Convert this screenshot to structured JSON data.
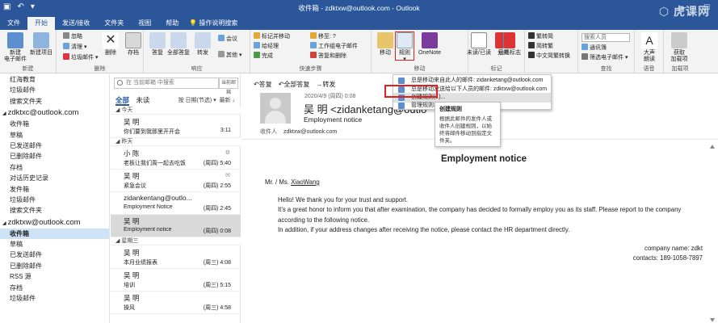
{
  "titlebar": {
    "title": "收件箱 - zdktxw@outlook.com - Outlook"
  },
  "tabs": [
    "文件",
    "开始",
    "发送/接收",
    "文件夹",
    "视图",
    "帮助"
  ],
  "tell_me": "操作说明搜索",
  "ribbon": {
    "new_email": "新建\n电子邮件",
    "new_items": "新建项目",
    "ignore": "忽略",
    "clean": "清理",
    "junk": "垃圾邮件",
    "delete": "删除",
    "archive": "存档",
    "reply": "答复",
    "reply_all": "全部答复",
    "forward": "转发",
    "meeting": "会议",
    "more": "其他",
    "move_to": "移至: ?",
    "to_manager": "工作组电子邮件",
    "team_email": "答复和删除",
    "move_and_move": "移至锁定移动",
    "qs1": "标记并移动",
    "qs2": "给经理",
    "qs3": "完成",
    "move": "移动",
    "rules": "规则",
    "onenote": "OneNote",
    "unread": "未读/已读",
    "categorize": "分类",
    "followup": "后续标志",
    "to_trad": "繁转简",
    "to_simp": "简转繁",
    "convert": "中文简繁转换",
    "search_people": "搜索人员",
    "address_book": "通讯簿",
    "filter_email": "筛选电子邮件",
    "read_aloud": "大声\n朗读",
    "get_addins": "获取\n加载项",
    "groups": {
      "new": "新建",
      "delete": "删除",
      "respond": "响应",
      "quick_steps": "快速步骤",
      "move": "移动",
      "tags": "标记",
      "find": "查找",
      "speech": "语音",
      "addins": "加载项"
    }
  },
  "folders": [
    {
      "type": "item",
      "label": "红海教育"
    },
    {
      "type": "item",
      "label": "垃圾邮件"
    },
    {
      "type": "item",
      "label": "搜索文件夹"
    },
    {
      "type": "account",
      "label": "zdktxc@outlook.com"
    },
    {
      "type": "item",
      "label": "收件箱"
    },
    {
      "type": "item",
      "label": "草稿"
    },
    {
      "type": "item",
      "label": "已发送邮件"
    },
    {
      "type": "item",
      "label": "已删除邮件"
    },
    {
      "type": "item",
      "label": "存档"
    },
    {
      "type": "item",
      "label": "对话历史记录"
    },
    {
      "type": "item",
      "label": "发件箱"
    },
    {
      "type": "item",
      "label": "垃圾邮件"
    },
    {
      "type": "item",
      "label": "搜索文件夹"
    },
    {
      "type": "account",
      "label": "zdktxw@outlook.com"
    },
    {
      "type": "item",
      "label": "收件箱",
      "selected": true
    },
    {
      "type": "item",
      "label": "草稿"
    },
    {
      "type": "item",
      "label": "已发送邮件"
    },
    {
      "type": "item",
      "label": "已删除邮件"
    },
    {
      "type": "item",
      "label": "RSS 源"
    },
    {
      "type": "item",
      "label": "存档"
    },
    {
      "type": "item",
      "label": "垃圾邮件"
    }
  ],
  "msglist": {
    "search_placeholder": "在 当前邮箱 中搜索",
    "scope": "当前邮箱",
    "filter_all": "全部",
    "filter_unread": "未读",
    "sort": "按 日期(节选)",
    "sort_dir": "最新",
    "groups": [
      {
        "header": "今天",
        "items": [
          {
            "from": "吴 明",
            "subject": "你们要到我那里开开会",
            "time": "3:11",
            "flag": ""
          }
        ]
      },
      {
        "header": "昨天",
        "items": [
          {
            "from": "小 陈",
            "subject": "老板让我们周一起去吃饭",
            "time": "(周四) 5:40",
            "flag": "⚙"
          },
          {
            "from": "吴 明",
            "subject": "紧急会议",
            "time": "(周四) 2:55",
            "flag": "✉"
          },
          {
            "from": "zidankentang@outlo...",
            "subject": "Employment Notice",
            "time": "(周四) 2:45",
            "flag": ""
          },
          {
            "from": "吴 明",
            "subject": "Employment notice",
            "time": "(周四) 0:08",
            "flag": "",
            "selected": true
          }
        ]
      },
      {
        "header": "星期三",
        "items": [
          {
            "from": "吴 明",
            "subject": "本月业绩报表",
            "time": "(周三) 4:08",
            "flag": ""
          },
          {
            "from": "吴 明",
            "subject": "培训",
            "time": "(周三) 5:15",
            "flag": ""
          },
          {
            "from": "吴 明",
            "subject": "操风",
            "time": "(周三) 4:58",
            "flag": ""
          }
        ]
      }
    ]
  },
  "reading": {
    "actions": [
      "答复",
      "全部答复",
      "转发"
    ],
    "date": "2020/4/9 (周四) 0:08",
    "sender": "吴 明 <zidanketang@outlo",
    "subject": "Employment notice",
    "to_label": "收件人",
    "to": "zdktxw@outlook.com",
    "email_title": "Employment notice",
    "salutation": "Mr. / Ms.",
    "salutation_name": "XiaoWang",
    "para1": "Hello! We thank you for your trust and support.",
    "para2": "It's a great honor to inform you that after examination, the company has decided to formally employ you as its staff. Please report to the company according to the following notice.",
    "para3": "In addition, if your address changes after receiving the notice, please contact the HR department directly.",
    "sign1": "company name: zdkt",
    "sign2": "contacts: 189-1058-7897"
  },
  "dropdown": {
    "item1": "总是移动来自此人的邮件: zidanketang@outlook.com",
    "item2": "总是移动发送给以下人员的邮件: zdktxw@outlook.com",
    "item3": "创建规则(L)...",
    "item4": "管理规则和通知(A)..."
  },
  "tooltip": {
    "title": "创建规则",
    "desc": "根据此邮件的发件人或收件人创建规则，以始终将邮件移动到指定文件夹。"
  },
  "watermark": "虎课网",
  "colors": {
    "brand": "#2b579a",
    "selection": "#cfe3f7",
    "highlight_box": "#e02020"
  }
}
